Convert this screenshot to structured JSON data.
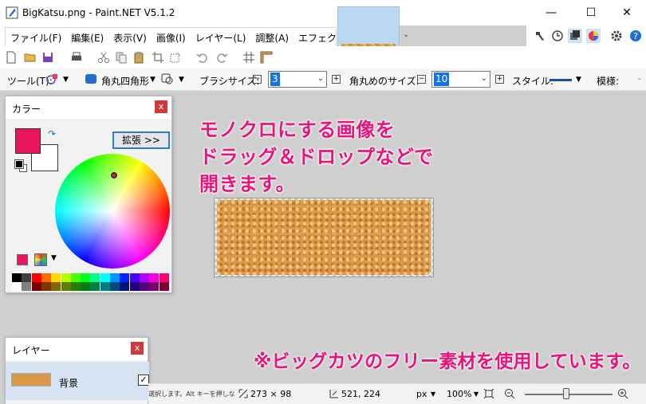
{
  "window": {
    "title": "BigKatsu.png - Paint.NET V5.1.2",
    "minimize": "—",
    "maximize": "☐",
    "close": "✕"
  },
  "menu": {
    "items": [
      {
        "label": "ファイル(F)"
      },
      {
        "label": "編集(E)"
      },
      {
        "label": "表示(V)"
      },
      {
        "label": "画像(I)"
      },
      {
        "label": "レイヤー(L)"
      },
      {
        "label": "調整(A)"
      },
      {
        "label": "エフェクト(C)"
      }
    ]
  },
  "options": {
    "tool_label": "ツール(T):",
    "shape_label": "角丸四角形",
    "brush_size_label": "ブラシサイズ:",
    "brush_size_value": "3",
    "radius_label": "角丸めのサイズ:",
    "radius_value": "10",
    "style_label": "スタイル:",
    "pattern_label": "模様:"
  },
  "annotations": {
    "main_lines": "モノクロにする画像を\nドラッグ＆ドロップなどで\n開きます。",
    "footnote": "※ビッグカツのフリー素材を使用しています。"
  },
  "color_panel": {
    "title": "カラー",
    "close": "x",
    "expand_button": "拡張 >>",
    "primary_color": "#e8155f",
    "secondary_color": "#ffffff"
  },
  "layers_panel": {
    "title": "レイヤー",
    "close": "x",
    "layer_name": "背景",
    "visible_check": "✓"
  },
  "status": {
    "hint": "選択します。Alt キーを押しながら中...",
    "image_size": "273 × 98",
    "cursor_pos": "521, 224",
    "unit": "px",
    "zoom": "100%"
  },
  "palette_colors": [
    "#000000",
    "#404040",
    "#ff0000",
    "#ff6a00",
    "#ffd800",
    "#b6ff00",
    "#4cff00",
    "#00ff21",
    "#00ff90",
    "#00ffff",
    "#0094ff",
    "#0026ff",
    "#4800ff",
    "#b200ff",
    "#ff00dc",
    "#ff006e",
    "#ffffff",
    "#808080",
    "#7f0000",
    "#7f3300",
    "#7f6a00",
    "#5b7f00",
    "#267f00",
    "#007f0e",
    "#007f46",
    "#007f7f",
    "#004a7f",
    "#00137f",
    "#21007f",
    "#57007f",
    "#7f006e",
    "#7f0037"
  ]
}
